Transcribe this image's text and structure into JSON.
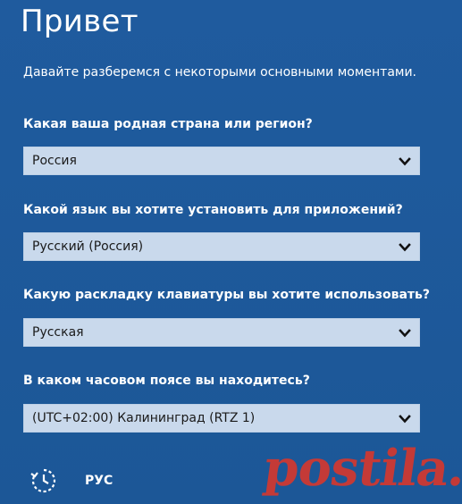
{
  "window": {
    "title": "Привет",
    "subtitle": "Давайте разберемся с некоторыми основными моментами."
  },
  "fields": [
    {
      "question": "Какая ваша родная страна или регион?",
      "value": "Россия",
      "icon": "chevron-down-icon"
    },
    {
      "question": "Какой язык вы хотите установить для приложений?",
      "value": "Русский (Россия)",
      "icon": "chevron-down-icon"
    },
    {
      "question": "Какую раскладку клавиатуры вы хотите использовать?",
      "value": "Русская",
      "icon": "chevron-down-icon"
    },
    {
      "question": "В каком часовом поясе вы находитесь?",
      "value": "(UTC+02:00) Калининград (RTZ 1)",
      "icon": "chevron-down-icon"
    }
  ],
  "bottom_bar": {
    "ease_of_access_icon": "ease-of-access-icon",
    "language_indicator": "РУС"
  },
  "watermark": {
    "text": "postila.ru",
    "color": "#d3382f"
  },
  "colors": {
    "background": "#1e5a9c",
    "select_background": "#c9d9ec",
    "text": "#ffffff"
  }
}
